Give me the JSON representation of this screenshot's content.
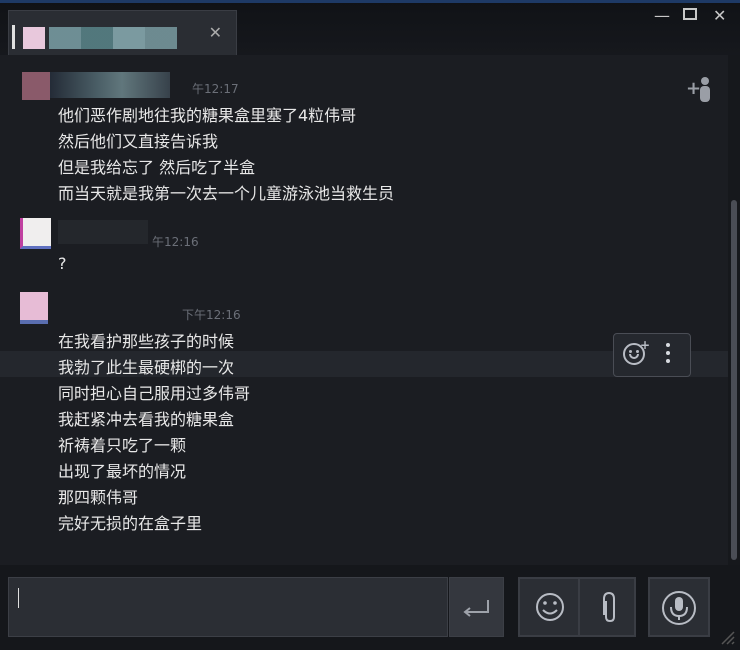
{
  "window": {
    "close_symbol": "✕",
    "minimize_symbol": "—",
    "maximize_symbol": "☐",
    "tab_close_symbol": "✕"
  },
  "messages": [
    {
      "timestamp": "午12:17",
      "lines": [
        "他们恶作剧地往我的糖果盒里塞了4粒伟哥",
        "然后他们又直接告诉我",
        "但是我给忘了 然后吃了半盒",
        "而当天就是我第一次去一个儿童游泳池当救生员"
      ]
    },
    {
      "timestamp": "午12:16",
      "lines": [
        "?"
      ]
    },
    {
      "timestamp": "下午12:16",
      "lines": [
        "在我看护那些孩子的时候",
        "我勃了此生最硬梆的一次",
        "同时担心自己服用过多伟哥",
        "我赶紧冲去看我的糖果盒",
        "祈祷着只吃了一颗",
        "出现了最坏的情况",
        "那四颗伟哥",
        "完好无损的在盒子里"
      ]
    }
  ],
  "icons": {
    "add_user": "add-user-icon",
    "emoji_reaction": "add-reaction-icon",
    "more": "more-vertical-icon",
    "send": "enter-icon",
    "emoji": "emoji-icon",
    "attach": "paperclip-icon",
    "voice": "microphone-icon"
  },
  "colors": {
    "background": "#1b1d22",
    "text": "#e8e8e8",
    "timestamp": "#6b6f78",
    "accent_line": "#1e3a66"
  }
}
